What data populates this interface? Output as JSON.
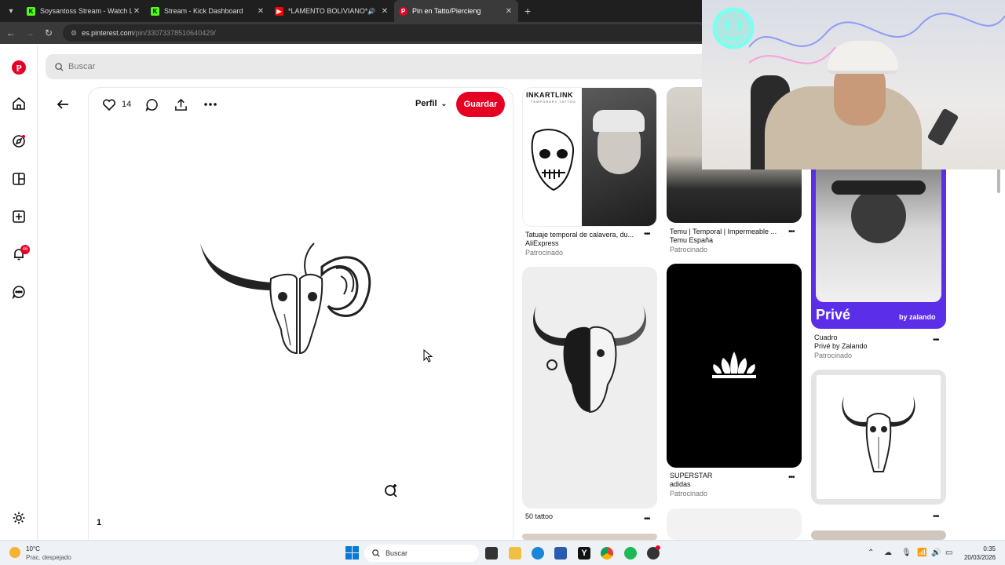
{
  "browser": {
    "tabs": [
      {
        "label": "Soysantoss Stream - Watch Live",
        "favicon": "kick-icon",
        "color": "#53fc18",
        "active": false
      },
      {
        "label": "Stream - Kick Dashboard",
        "favicon": "kick-icon",
        "color": "#53fc18",
        "active": false
      },
      {
        "label": "*LAMENTO BOLIVIANO* - ",
        "favicon": "youtube-icon",
        "color": "#ff0000",
        "active": false
      },
      {
        "label": "Pin en Tatto/Piercieng",
        "favicon": "pinterest-icon",
        "color": "#e60023",
        "active": true
      }
    ],
    "url_host": "es.pinterest.com",
    "url_path": "/pin/330733785106404​29/"
  },
  "search": {
    "placeholder": "Buscar"
  },
  "rail": {
    "notifications_count": "46"
  },
  "pin": {
    "likes": "14",
    "perfil_label": "Perfil",
    "save_label": "Guardar",
    "page_number": "1"
  },
  "grid": {
    "col1": [
      {
        "caption": "Tatuaje temporal de calavera, du...",
        "source": "AliExpress",
        "sponsored": "Patrocinado",
        "brand_text": "INKARTLINK",
        "brand_sub": "TEMPORARY TATTOO"
      },
      {
        "caption": "50 tattoo"
      }
    ],
    "col2": [
      {
        "caption": "Temu | Temporal | Impermeable ...",
        "source": "Temu España",
        "sponsored": "Patrocinado"
      },
      {
        "caption": "SUPERSTAR",
        "source": "adidas",
        "sponsored": "Patrocinado"
      }
    ],
    "col3": [
      {
        "caption": "Cuadro",
        "source": "Privé by Zalando",
        "sponsored": "Patrocinado",
        "ad_text": "Privé",
        "ad_sub": "by zalando"
      },
      {
        "caption": ""
      }
    ]
  },
  "taskbar": {
    "weather_temp": "10°C",
    "weather_desc": "Prac. despejado",
    "search_placeholder": "Buscar",
    "time": "0:35",
    "date": "20/03/2026"
  },
  "colors": {
    "accent": "#e60023",
    "zalando": "#5b2ee8"
  }
}
